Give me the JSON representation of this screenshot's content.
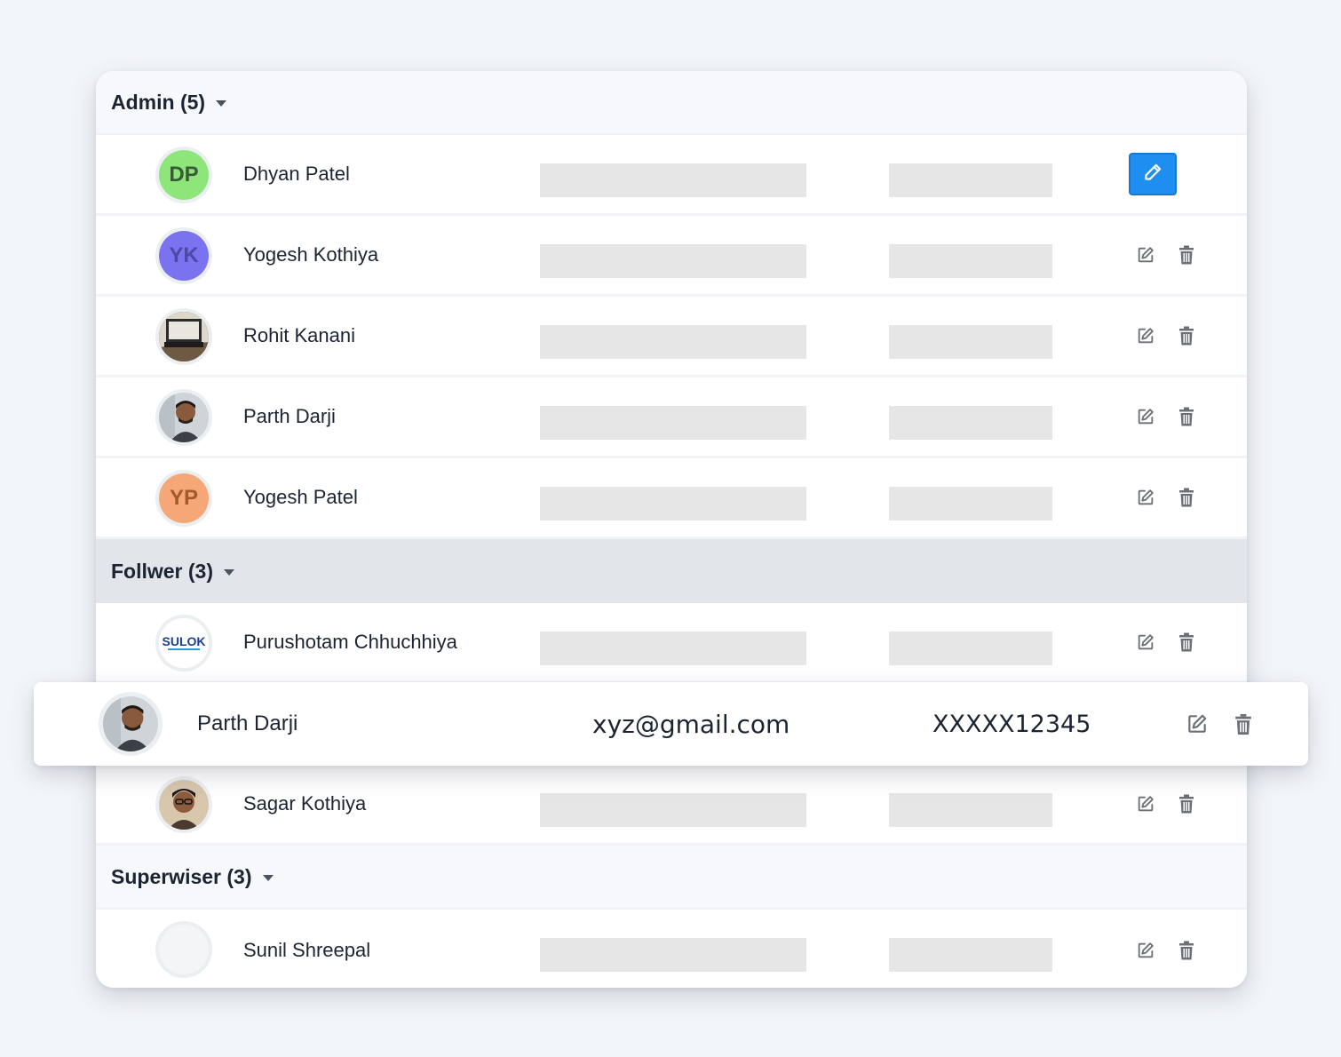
{
  "groups": [
    {
      "header": "Admin (5)",
      "members": [
        {
          "name": "Dhyan Patel",
          "initials": "DP",
          "avatar_bg": "#8ee67a",
          "avatar_fg": "#3a5a3a",
          "avatar_type": "initials"
        },
        {
          "name": "Yogesh Kothiya",
          "initials": "YK",
          "avatar_bg": "#7b72f0",
          "avatar_fg": "#4a4aa6",
          "avatar_type": "initials"
        },
        {
          "name": "Rohit Kanani",
          "initials": "",
          "avatar_type": "photo-laptop"
        },
        {
          "name": "Parth Darji",
          "initials": "",
          "avatar_type": "photo-person"
        },
        {
          "name": "Yogesh Patel",
          "initials": "YP",
          "avatar_bg": "#f6a777",
          "avatar_fg": "#a05a2c",
          "avatar_type": "initials"
        }
      ]
    },
    {
      "header": "Follwer (3)",
      "members": [
        {
          "name": "Purushotam Chhuchhiya",
          "initials": "",
          "avatar_type": "logo-sulok",
          "logo_text": "SULOK"
        },
        {
          "name": "Sagar Kothiya",
          "initials": "",
          "avatar_type": "photo-person"
        }
      ]
    },
    {
      "header": "Superwiser (3)",
      "members": [
        {
          "name": "Sunil Shreepal",
          "initials": "",
          "avatar_type": "empty"
        }
      ]
    }
  ],
  "dragged_row": {
    "name": "Parth Darji",
    "email": "xyz@gmail.com",
    "phone": "XXXXX12345"
  },
  "icons": {
    "edit": "edit-square-icon",
    "delete": "trash-icon",
    "edit_active": "pencil-icon",
    "caret": "caret-down-icon"
  },
  "colors": {
    "accent": "#1e8ff0",
    "placeholder": "#e6e6e6",
    "header_active": "#e2e6eb"
  }
}
